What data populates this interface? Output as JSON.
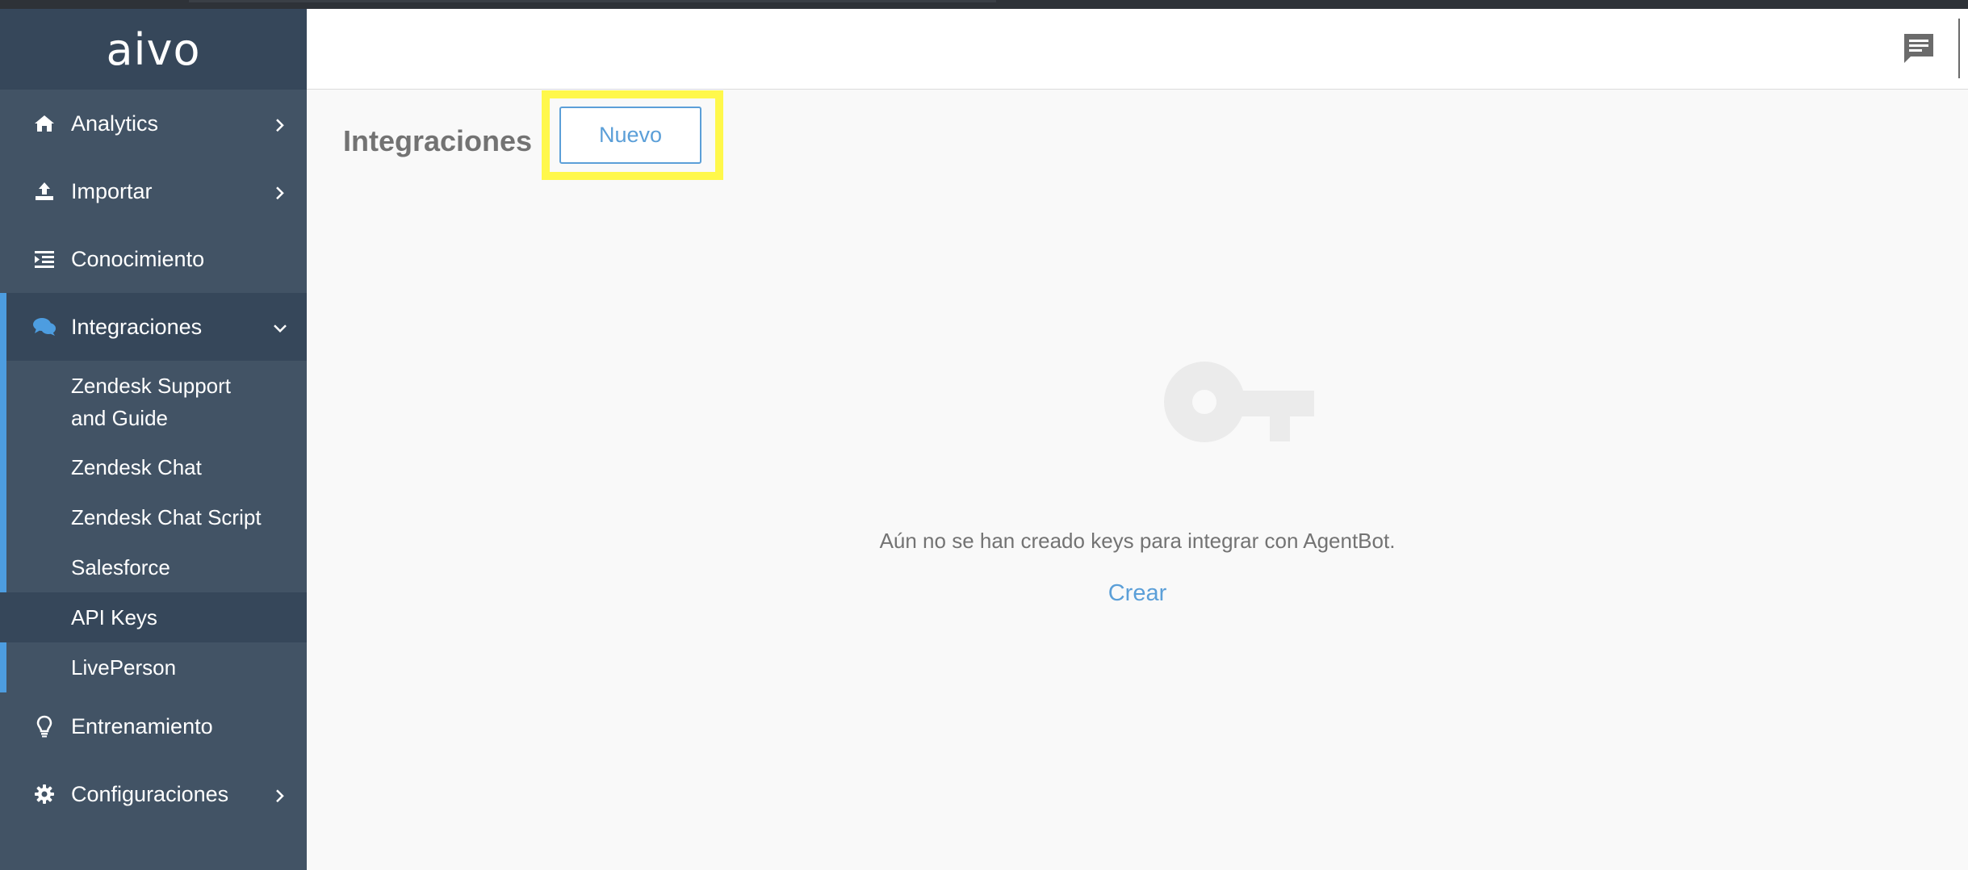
{
  "brand": {
    "logo_text": "aivo"
  },
  "sidebar": {
    "items": [
      {
        "label": "Analytics",
        "icon": "home-icon"
      },
      {
        "label": "Importar",
        "icon": "upload-icon"
      },
      {
        "label": "Conocimiento",
        "icon": "list-indent-icon"
      },
      {
        "label": "Integraciones",
        "icon": "comments-icon",
        "expanded": true
      },
      {
        "label": "Entrenamiento",
        "icon": "lightbulb-icon"
      },
      {
        "label": "Configuraciones",
        "icon": "gear-icon"
      }
    ],
    "integraciones_sub": [
      {
        "label_line1": "Zendesk Support",
        "label_line2": "and Guide"
      },
      {
        "label": "Zendesk Chat"
      },
      {
        "label": "Zendesk Chat Script"
      },
      {
        "label": "Salesforce"
      },
      {
        "label": "API Keys",
        "selected": true
      },
      {
        "label": "LivePerson"
      }
    ]
  },
  "header": {
    "chat_icon": "chat-icon"
  },
  "main": {
    "title": "Integraciones",
    "new_button": "Nuevo",
    "empty_icon": "key-icon",
    "empty_message": "Aún no se han creado keys para integrar con AgentBot.",
    "create_link": "Crear"
  },
  "colors": {
    "sidebar_bg": "#425365",
    "sidebar_dark": "#36475a",
    "accent": "#4d9de0",
    "link": "#5b9fd8",
    "highlight": "#fff84b"
  }
}
